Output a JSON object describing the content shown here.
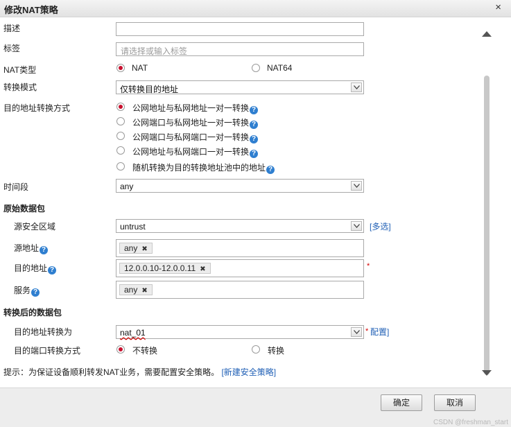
{
  "dialog": {
    "title": "修改NAT策略",
    "close": "×"
  },
  "form": {
    "description": {
      "label": "描述",
      "value": ""
    },
    "tags": {
      "label": "标签",
      "placeholder": "请选择或输入标签"
    },
    "nat_type": {
      "label": "NAT类型",
      "options": [
        "NAT",
        "NAT64"
      ],
      "selected": "NAT"
    },
    "convert_mode": {
      "label": "转换模式",
      "value": "仅转换目的地址"
    },
    "dest_method": {
      "label": "目的地址转换方式",
      "options": [
        "公网地址与私网地址一对一转换",
        "公网端口与私网地址一对一转换",
        "公网端口与私网端口一对一转换",
        "公网地址与私网端口一对一转换",
        "随机转换为目的转换地址池中的地址"
      ],
      "selected_index": 0
    },
    "time_range": {
      "label": "时间段",
      "value": "any"
    }
  },
  "original_packet": {
    "title": "原始数据包",
    "src_zone": {
      "label": "源安全区域",
      "value": "untrust",
      "link": "[多选]"
    },
    "src_addr": {
      "label": "源地址",
      "tag": "any"
    },
    "dst_addr": {
      "label": "目的地址",
      "tag": "12.0.0.10-12.0.0.11",
      "required": "*"
    },
    "service": {
      "label": "服务",
      "tag": "any"
    }
  },
  "translated_packet": {
    "title": "转换后的数据包",
    "dst_translate": {
      "label": "目的地址转换为",
      "value": "nat_01",
      "required": "*",
      "link": "配置]"
    },
    "port_method": {
      "label": "目的端口转换方式",
      "options": [
        "不转换",
        "转换"
      ],
      "selected": "不转换"
    }
  },
  "hint": {
    "text": "提示：为保证设备顺利转发NAT业务，需要配置安全策略。",
    "link": "[新建安全策略]"
  },
  "buttons": {
    "ok": "确定",
    "cancel": "取消"
  },
  "watermark": "CSDN @freshman_start",
  "help_glyph": "?",
  "tag_remove_glyph": "✖",
  "colors": {
    "accent_red": "#c8102e",
    "link_blue": "#1f5fb5",
    "help_blue": "#2f7fd0"
  }
}
